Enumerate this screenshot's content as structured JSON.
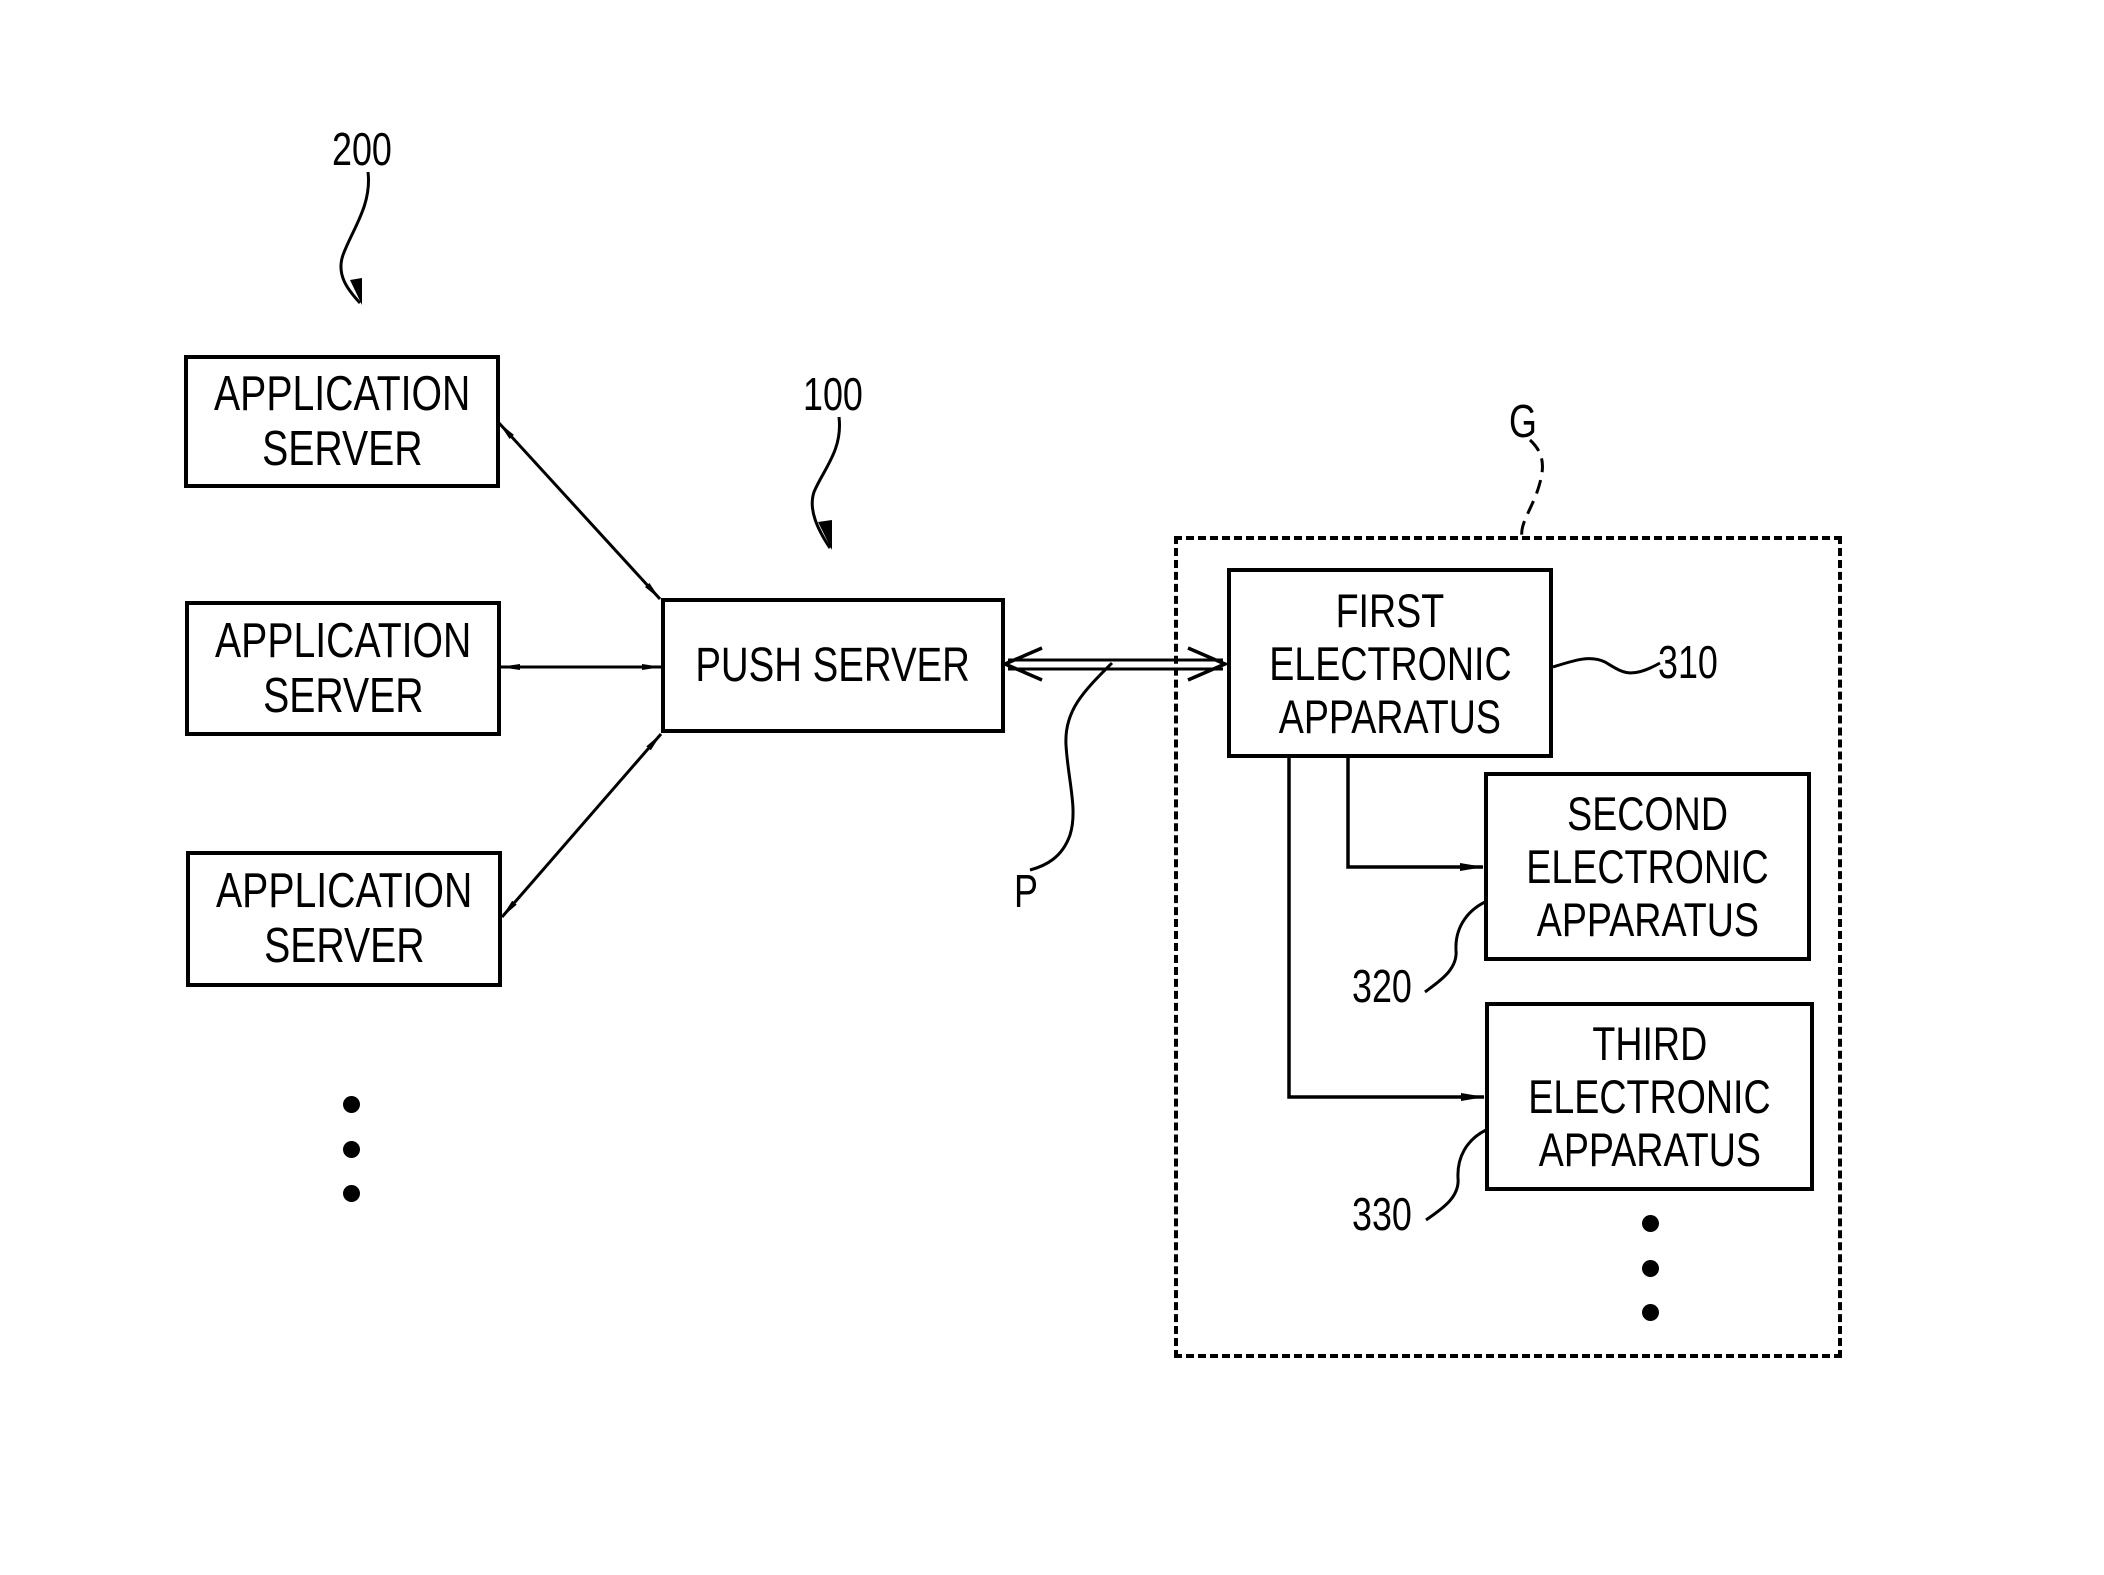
{
  "figure": {
    "type": "block-diagram",
    "reference_labels": {
      "app_server_group": "200",
      "push_server": "100",
      "group": "G",
      "connection": "P",
      "first_device": "310",
      "second_device": "320",
      "third_device": "330"
    },
    "application_servers": [
      {
        "lines": [
          "APPLICATION",
          "SERVER"
        ]
      },
      {
        "lines": [
          "APPLICATION",
          "SERVER"
        ]
      },
      {
        "lines": [
          "APPLICATION",
          "SERVER"
        ]
      }
    ],
    "application_servers_continuation": "more application servers (vertical ellipsis)",
    "push_server": {
      "lines": [
        "PUSH SERVER"
      ]
    },
    "group": {
      "style": "dashed",
      "devices": [
        {
          "lines": [
            "FIRST",
            "ELECTRONIC",
            "APPARATUS"
          ]
        },
        {
          "lines": [
            "SECOND",
            "ELECTRONIC",
            "APPARATUS"
          ]
        },
        {
          "lines": [
            "THIRD",
            "ELECTRONIC",
            "APPARATUS"
          ]
        }
      ],
      "devices_continuation": "more electronic apparatuses (vertical ellipsis)"
    },
    "connections": [
      {
        "from": "application_server_1",
        "to": "push_server",
        "direction": "bidirectional"
      },
      {
        "from": "application_server_2",
        "to": "push_server",
        "direction": "bidirectional"
      },
      {
        "from": "application_server_3",
        "to": "push_server",
        "direction": "bidirectional"
      },
      {
        "from": "push_server",
        "to": "first_electronic_apparatus",
        "direction": "bidirectional",
        "style": "double-line",
        "label": "P"
      },
      {
        "from": "first_electronic_apparatus",
        "to": "second_electronic_apparatus",
        "direction": "one-way"
      },
      {
        "from": "first_electronic_apparatus",
        "to": "third_electronic_apparatus",
        "direction": "one-way"
      }
    ]
  }
}
